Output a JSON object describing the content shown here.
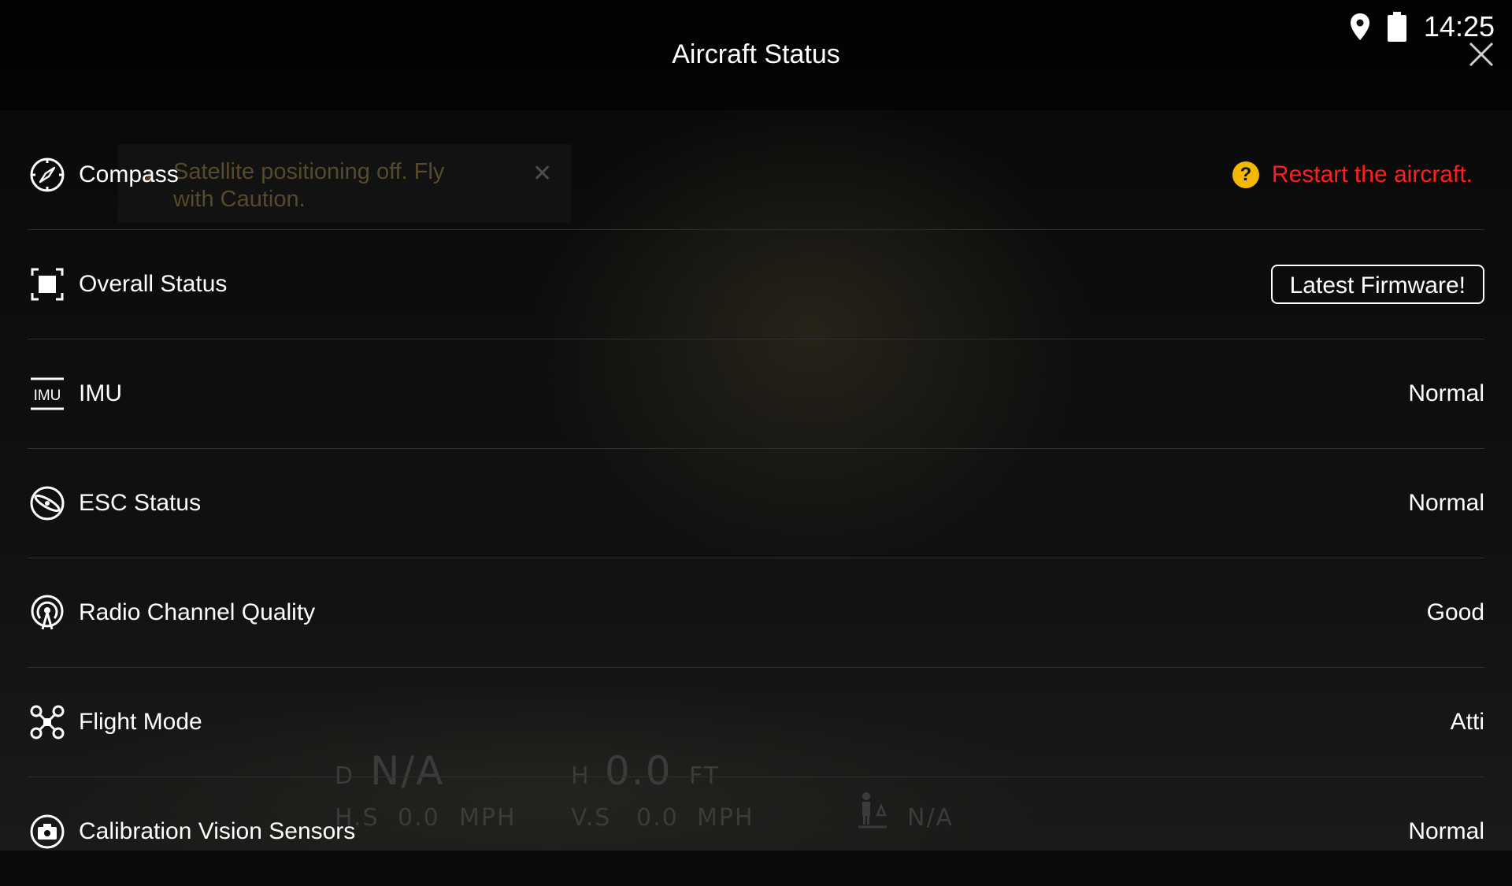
{
  "window": {
    "title": "Aircraft Status"
  },
  "statusbar": {
    "time": "14:25",
    "icons": [
      "location-icon",
      "battery-icon"
    ]
  },
  "toast": {
    "message": "Satellite positioning off. Fly with Caution."
  },
  "telemetry": {
    "d_label": "D",
    "d_value": "N/A",
    "h_label": "H",
    "h_value": "0.0",
    "h_unit": "FT",
    "hs_label": "H.S",
    "hs_value": "0.0",
    "hs_unit": "MPH",
    "vs_label": "V.S",
    "vs_value": "0.0",
    "vs_unit": "MPH",
    "person_value": "N/A"
  },
  "rows": [
    {
      "label": "Compass",
      "icon": "compass-icon",
      "alert": "Restart the aircraft."
    },
    {
      "label": "Overall Status",
      "icon": "overall-status-icon",
      "button": "Latest Firmware!"
    },
    {
      "label": "IMU",
      "icon": "imu-icon",
      "value": "Normal"
    },
    {
      "label": "ESC Status",
      "icon": "esc-icon",
      "value": "Normal"
    },
    {
      "label": "Radio Channel Quality",
      "icon": "radio-icon",
      "value": "Good"
    },
    {
      "label": "Flight Mode",
      "icon": "drone-icon",
      "value": "Atti"
    },
    {
      "label": "Calibration Vision Sensors",
      "icon": "camera-icon",
      "value": "Normal"
    }
  ],
  "colors": {
    "alert_text": "#ff1e1e",
    "alert_badge": "#f5b800",
    "background": "#0b0b0b"
  }
}
